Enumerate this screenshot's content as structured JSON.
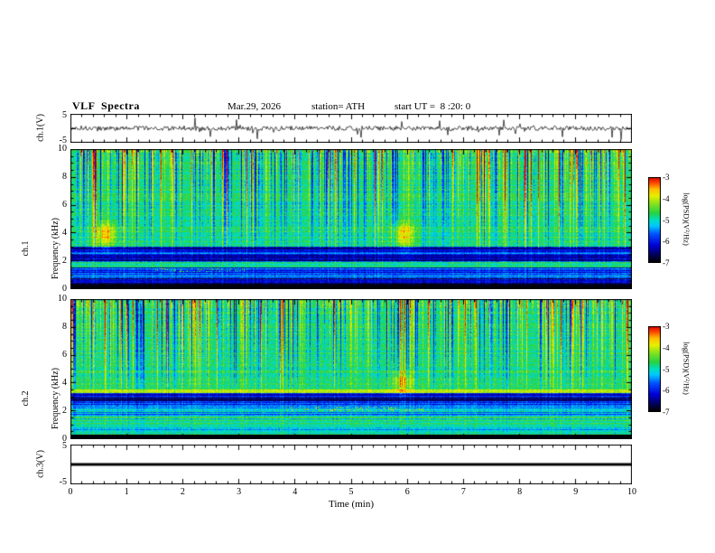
{
  "title": "VLF  Spectra",
  "header": {
    "date": "Mar.29, 2026",
    "station": "station= ATH",
    "start_ut": "start UT =  8 :20: 0"
  },
  "axes": {
    "x_label": "Time (min)",
    "x_ticks": [
      "0",
      "1",
      "2",
      "3",
      "4",
      "5",
      "6",
      "7",
      "8",
      "9",
      "10"
    ],
    "x_range": [
      0,
      10
    ],
    "spec_y_ticks": [
      "0",
      "2",
      "4",
      "6",
      "8",
      "10"
    ],
    "spec_y_range": [
      0,
      10
    ],
    "wave_y_ticks": [
      "5",
      "-5"
    ],
    "wave_y_range": [
      -5,
      5
    ],
    "colorbar_ticks": [
      "-3",
      "-4",
      "-5",
      "-6",
      "-7"
    ]
  },
  "labels": {
    "ch1_wave": "ch.1(V)",
    "ch1_spec_line1": "ch.1",
    "ch1_spec_line2": "Frequency (kHz)",
    "ch2_spec_line1": "ch.2",
    "ch2_spec_line2": "Frequency (kHz)",
    "ch3_wave": "ch.3(V)",
    "colorbar": "log(PSD)(V²/Hz)"
  },
  "colormap": {
    "range": [
      -7,
      -3
    ],
    "stops": [
      [
        0.0,
        "#000000"
      ],
      [
        0.08,
        "#000050"
      ],
      [
        0.2,
        "#0000d8"
      ],
      [
        0.33,
        "#0050ff"
      ],
      [
        0.43,
        "#00c8ff"
      ],
      [
        0.5,
        "#00e0c0"
      ],
      [
        0.58,
        "#28d244"
      ],
      [
        0.68,
        "#7ce322"
      ],
      [
        0.78,
        "#e8f000"
      ],
      [
        0.86,
        "#ffc000"
      ],
      [
        0.93,
        "#ff5000"
      ],
      [
        1.0,
        "#dd0000"
      ]
    ]
  },
  "chart_data": [
    {
      "type": "line",
      "name": "ch1_time_series",
      "xlabel": "Time (min)",
      "xlim": [
        0,
        10
      ],
      "ylabel": "ch.1(V)",
      "ylim": [
        -5,
        5
      ],
      "line_color": "#000000",
      "character": "continuous broadband noise of about ±0.8 V with frequent impulsive sferic spikes reaching ±4 V across the whole 10 minutes"
    },
    {
      "type": "heatmap",
      "name": "ch1_spectrogram",
      "xlabel": "Time (min)",
      "xlim": [
        0,
        10
      ],
      "ylabel": "Frequency (kHz)",
      "ylim": [
        0,
        10
      ],
      "zlabel": "log(PSD)(V²/Hz)",
      "zlim": [
        -7,
        -3
      ],
      "noise": 0.5,
      "bands": [
        {
          "f": [
            0.0,
            0.35
          ],
          "level": -7.0,
          "rough": 0.0,
          "note": "solid black band at lowest frequencies"
        },
        {
          "f": [
            0.35,
            0.75
          ],
          "level": -6.3,
          "rough": 0.5,
          "note": "dark blue band"
        },
        {
          "f": [
            0.75,
            1.15
          ],
          "level": -5.3,
          "rough": 0.55,
          "note": "cyan/blue mixed band"
        },
        {
          "f": [
            1.15,
            1.55
          ],
          "level": -5.8,
          "rough": 0.5,
          "note": "blue band"
        },
        {
          "f": [
            1.55,
            1.95
          ],
          "level": -4.9,
          "rough": 0.3,
          "note": "green horizontal band near 1.8 kHz"
        },
        {
          "f": [
            1.95,
            3.05
          ],
          "level": -6.0,
          "rough": 0.7,
          "note": "dark blue striped band 2-3 kHz"
        },
        {
          "f": [
            3.05,
            10.0
          ],
          "level": -4.8,
          "rough": 0.2,
          "note": "green field with dense vertical sferic streaks"
        }
      ],
      "streaks": {
        "prob": 0.5,
        "dark_frac": 0.55,
        "max": 2.4,
        "min_khz": 3.0,
        "note": "dense vertical striations; mix of dark blue and bright yellow-red columns, red flecks concentrated near 9-10 kHz"
      },
      "blobs": [
        {
          "x": 0.62,
          "f": 3.9,
          "rx": 0.2,
          "rf": 0.9,
          "amp": 1.2,
          "note": "bright green patch"
        },
        {
          "x": 5.92,
          "f": 3.9,
          "rx": 0.2,
          "rf": 0.9,
          "amp": 1.1,
          "note": "bright green patch"
        }
      ],
      "segments": [
        {
          "x": [
            1.5,
            3.1
          ],
          "f": [
            1.2,
            1.5
          ],
          "amp": 1.6,
          "note": "reddish speckle row"
        }
      ]
    },
    {
      "type": "heatmap",
      "name": "ch2_spectrogram",
      "xlabel": "Time (min)",
      "xlim": [
        0,
        10
      ],
      "ylabel": "Frequency (kHz)",
      "ylim": [
        0,
        10
      ],
      "zlabel": "log(PSD)(V²/Hz)",
      "zlim": [
        -7,
        -3
      ],
      "noise": 0.5,
      "bands": [
        {
          "f": [
            0.0,
            0.3
          ],
          "level": -7.0,
          "rough": 0.0,
          "note": "solid black band at lowest frequencies"
        },
        {
          "f": [
            0.3,
            0.55
          ],
          "level": -4.9,
          "rough": 0.4,
          "note": "green-yellow stripe"
        },
        {
          "f": [
            0.55,
            1.1
          ],
          "level": -5.2,
          "rough": 0.5,
          "note": "green with horizontal striping"
        },
        {
          "f": [
            1.1,
            1.6
          ],
          "level": -5.0,
          "rough": 0.5,
          "note": "green band"
        },
        {
          "f": [
            1.6,
            2.3
          ],
          "level": -5.3,
          "rough": 0.6,
          "note": "green/cyan striped band"
        },
        {
          "f": [
            2.3,
            2.65
          ],
          "level": -5.9,
          "rough": 0.5,
          "note": "darker band"
        },
        {
          "f": [
            2.65,
            3.3
          ],
          "level": -6.4,
          "rough": 0.7,
          "note": "dark blue/black striped band"
        },
        {
          "f": [
            3.3,
            3.55
          ],
          "level": -4.1,
          "rough": 0.15,
          "note": "bright yellow-green horizontal line near 3.4 kHz"
        },
        {
          "f": [
            3.55,
            10.0
          ],
          "level": -4.8,
          "rough": 0.2,
          "note": "green field with dense vertical sferic streaks"
        }
      ],
      "streaks": {
        "prob": 0.5,
        "dark_frac": 0.5,
        "max": 2.4,
        "min_khz": 3.6,
        "note": "vertical striations as in ch.1, slightly more yellow overall"
      },
      "blobs": [
        {
          "x": 5.9,
          "f": 4.1,
          "rx": 0.18,
          "rf": 0.8,
          "amp": 0.9,
          "note": "bright green patch"
        }
      ],
      "segments": [
        {
          "x": [
            3.8,
            6.3
          ],
          "f": [
            2.0,
            2.35
          ],
          "amp": 1.5,
          "note": "reddish speckle row near 2.2 kHz"
        }
      ]
    },
    {
      "type": "line",
      "name": "ch3_time_series",
      "xlabel": "Time (min)",
      "xlim": [
        0,
        10
      ],
      "ylabel": "ch.3(V)",
      "ylim": [
        -5,
        5
      ],
      "line_color": "#000000",
      "flat_value": 0,
      "character": "perfectly flat thick black line at 0 V (channel inactive)"
    }
  ]
}
